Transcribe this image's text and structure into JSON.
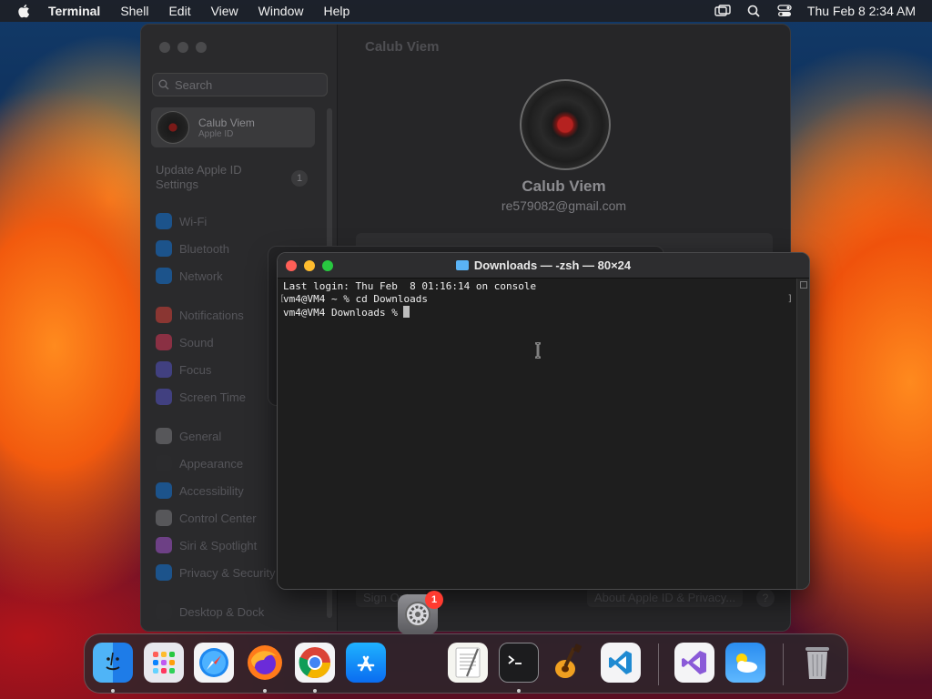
{
  "menubar": {
    "app": "Terminal",
    "items": [
      "Shell",
      "Edit",
      "View",
      "Window",
      "Help"
    ],
    "clock": "Thu Feb 8  2:34 AM"
  },
  "settings": {
    "title": "Calub Viem",
    "search_placeholder": "Search",
    "account": {
      "name": "Calub Viem",
      "sub": "Apple ID"
    },
    "update_label": "Update Apple ID Settings",
    "update_badge": "1",
    "sidebar_items": [
      {
        "label": "Wi-Fi",
        "color": "#0a84ff"
      },
      {
        "label": "Bluetooth",
        "color": "#0a84ff"
      },
      {
        "label": "Network",
        "color": "#0a84ff"
      },
      {
        "label": "Notifications",
        "color": "#ff453a"
      },
      {
        "label": "Sound",
        "color": "#ff375f"
      },
      {
        "label": "Focus",
        "color": "#5e5ce6"
      },
      {
        "label": "Screen Time",
        "color": "#5e5ce6"
      },
      {
        "label": "General",
        "color": "#8e8e93"
      },
      {
        "label": "Appearance",
        "color": "#2c2c2e"
      },
      {
        "label": "Accessibility",
        "color": "#0a84ff"
      },
      {
        "label": "Control Center",
        "color": "#8e8e93"
      },
      {
        "label": "Siri & Spotlight",
        "color": "#bf5af2"
      },
      {
        "label": "Privacy & Security",
        "color": "#0a84ff"
      },
      {
        "label": "Desktop & Dock",
        "color": "#2c2c2e"
      }
    ],
    "user_name": "Calub Viem",
    "user_email": "re579082@gmail.com",
    "sign_out": "Sign Out...",
    "about": "About Apple ID & Privacy...",
    "help": "?"
  },
  "terminal": {
    "title": "Downloads — -zsh — 80×24",
    "lines": [
      "Last login: Thu Feb  8 01:16:14 on console",
      "vm4@VM4 ~ % cd Downloads",
      "vm4@VM4 Downloads % "
    ]
  },
  "dock": {
    "badge": "1",
    "apps": [
      "Finder",
      "Launchpad",
      "Safari",
      "Firefox",
      "Chrome",
      "App Store",
      "TextEdit",
      "Terminal",
      "GarageBand",
      "VS Code",
      "Visual Studio",
      "Weather",
      "Trash"
    ]
  }
}
